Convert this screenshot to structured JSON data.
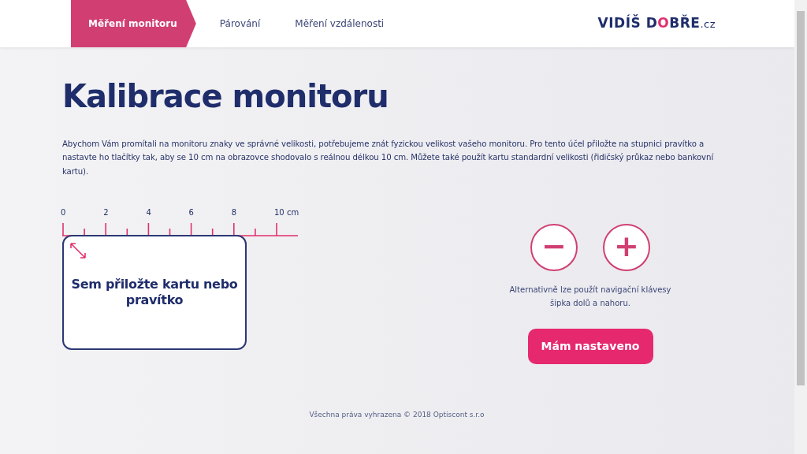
{
  "nav": {
    "tabs": [
      {
        "label": "Měření monitoru",
        "selected": true
      },
      {
        "label": "Párování",
        "selected": false
      },
      {
        "label": "Měření vzdálenosti",
        "selected": false
      }
    ],
    "logo": {
      "part_1": "VIDÍŠ D",
      "accent": "O",
      "part_2": "BŘE",
      "suffix": ".cz"
    }
  },
  "title": "Kalibrace monitoru",
  "intro": "Abychom Vám promítali na monitoru znaky ve správné velikosti, potřebujeme znát fyzickou velikost vašeho monitoru. Pro tento účel přiložte na stupnici pravítko a nastavte ho tlačítky tak, aby se 10 cm na obrazovce shodovalo s reálnou délkou 10 cm. Můžete také použít kartu standardní velikosti (řidičský průkaz nebo bankovní kartu).",
  "ruler": {
    "labels": [
      "0",
      "2",
      "4",
      "6",
      "8",
      "10 cm"
    ]
  },
  "card_text": "Sem přiložte kartu nebo pravítko",
  "controls": {
    "minus": "−",
    "plus": "+",
    "hint": "Alternativně lze použít navigační klávesy šipka dolů a nahoru.",
    "confirm": "Mám nastaveno"
  },
  "footer": "Všechna práva vyhrazena © 2018 Optiscont s.r.o"
}
